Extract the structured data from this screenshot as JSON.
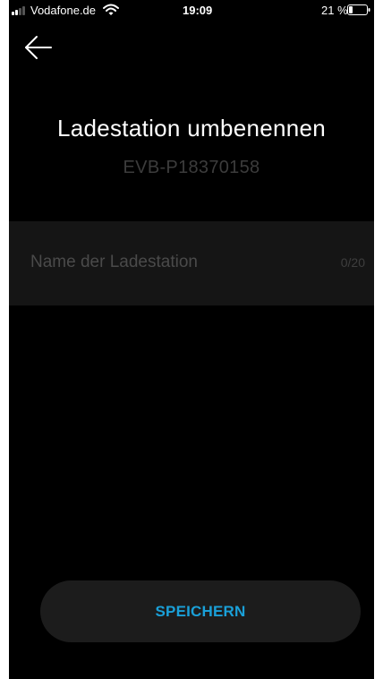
{
  "status_bar": {
    "carrier": "Vodafone.de",
    "time": "19:09",
    "battery_percent": "21 %",
    "battery_level": 0.21,
    "signal_bars": 2,
    "signal_total": 4
  },
  "header": {
    "back_icon": "arrow-left-icon"
  },
  "main": {
    "title": "Ladestation umbenennen",
    "station_id": "EVB-P18370158"
  },
  "name_field": {
    "value": "",
    "placeholder": "Name der Ladestation",
    "counter": "0/20"
  },
  "actions": {
    "save_label": "SPEICHERN"
  },
  "colors": {
    "background": "#000000",
    "accent": "#1aa0d8",
    "field_background": "#151515",
    "button_background": "#1c1c1c"
  }
}
